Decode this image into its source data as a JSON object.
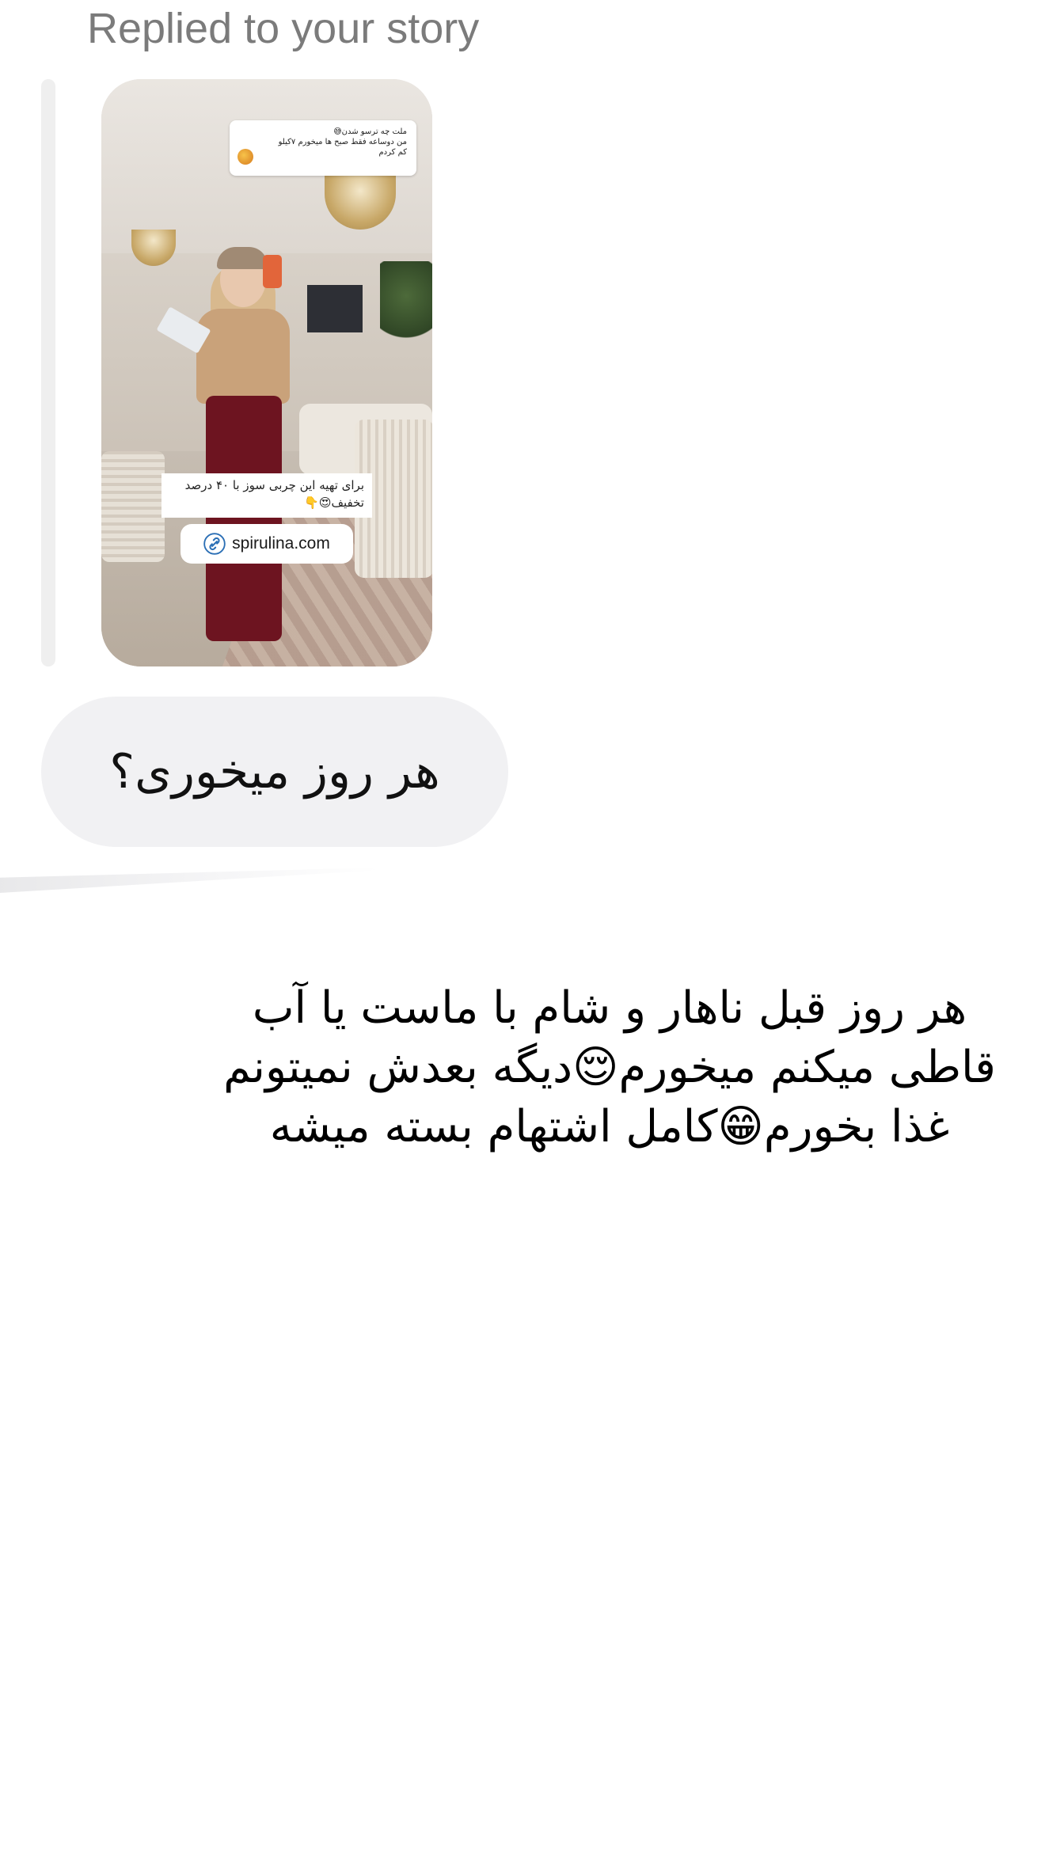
{
  "reply": {
    "header": "Replied to your story"
  },
  "story": {
    "question_line1": "ملت چه ترسو شدن😅",
    "question_line2": "من دوساعه فقط صبح ها میخورم ۷کیلو",
    "question_line3": "کم کردم",
    "caption": "برای تهیه این چربی سوز با ۴۰ درصد تخفیف😍👇",
    "link": "spirulina.com"
  },
  "message": {
    "text": "هر روز میخوری؟"
  },
  "caption": {
    "line1": "هر روز قبل ناهار و شام با ماست یا آب",
    "line2": "قاطی میکنم میخورم😌دیگه بعدش نمیتونم",
    "line3": "غذا بخورم😁کامل اشتهام بسته میشه"
  }
}
